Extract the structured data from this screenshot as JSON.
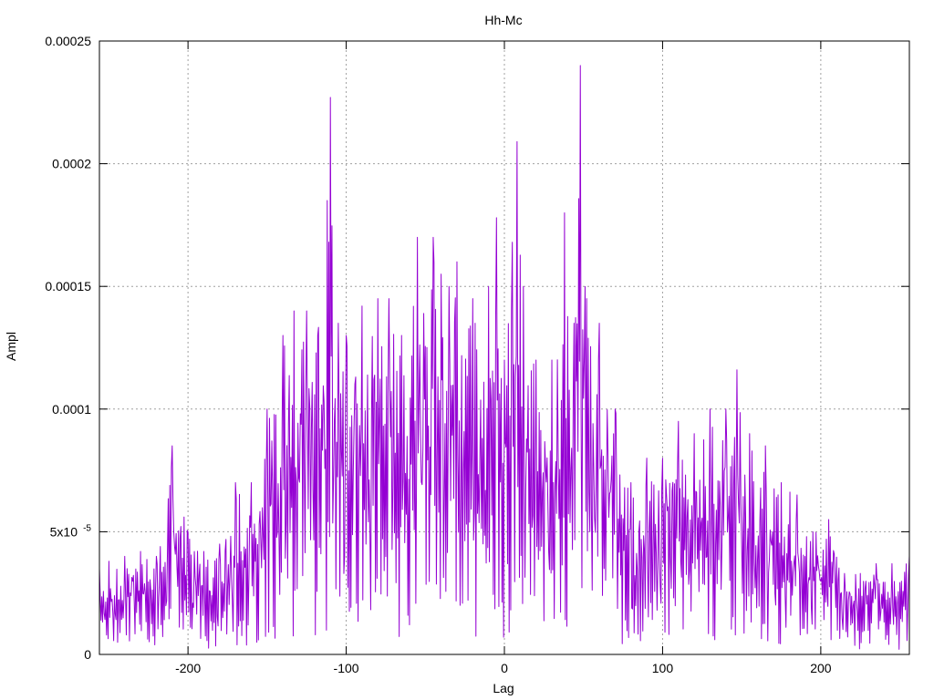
{
  "chart_data": {
    "type": "line",
    "title": "Hh-Mc",
    "xlabel": "Lag",
    "ylabel": "Ampl",
    "xlim": [
      -256,
      256
    ],
    "ylim": [
      0,
      0.00025
    ],
    "grid": true,
    "line_color": "#9400d3",
    "xticks": [
      {
        "value": -200,
        "label": "-200"
      },
      {
        "value": -100,
        "label": "-100"
      },
      {
        "value": 0,
        "label": "0"
      },
      {
        "value": 100,
        "label": "100"
      },
      {
        "value": 200,
        "label": "200"
      }
    ],
    "yticks": [
      {
        "value": 0,
        "label": "0"
      },
      {
        "value": 5e-05,
        "label": "5x10",
        "sup": "-5"
      },
      {
        "value": 0.0001,
        "label": "0.0001"
      },
      {
        "value": 0.00015,
        "label": "0.00015"
      },
      {
        "value": 0.0002,
        "label": "0.0002"
      },
      {
        "value": 0.00025,
        "label": "0.00025"
      }
    ],
    "series": [
      {
        "envelope": [
          [
            -256,
            3.5e-05
          ],
          [
            -250,
            3.8e-05
          ],
          [
            -240,
            4e-05
          ],
          [
            -230,
            4.2e-05
          ],
          [
            -220,
            4e-05
          ],
          [
            -210,
            8.5e-05
          ],
          [
            -200,
            5e-05
          ],
          [
            -190,
            4.2e-05
          ],
          [
            -180,
            4.5e-05
          ],
          [
            -170,
            7e-05
          ],
          [
            -160,
            7e-05
          ],
          [
            -150,
            0.0001
          ],
          [
            -140,
            0.00013
          ],
          [
            -133,
            0.00014
          ],
          [
            -125,
            0.00014
          ],
          [
            -118,
            0.00013
          ],
          [
            -112,
            0.000185
          ],
          [
            -110,
            0.000227
          ],
          [
            -105,
            0.000135
          ],
          [
            -100,
            0.00013
          ],
          [
            -90,
            0.000142
          ],
          [
            -80,
            0.000145
          ],
          [
            -73,
            0.000145
          ],
          [
            -65,
            0.00013
          ],
          [
            -55,
            0.00017
          ],
          [
            -45,
            0.00017
          ],
          [
            -40,
            0.000155
          ],
          [
            -35,
            0.00015
          ],
          [
            -30,
            0.00016
          ],
          [
            -20,
            0.000145
          ],
          [
            -10,
            0.00015
          ],
          [
            -5,
            0.000178
          ],
          [
            0,
            0.00012
          ],
          [
            5,
            0.000168
          ],
          [
            8,
            0.000209
          ],
          [
            12,
            0.00015
          ],
          [
            20,
            0.00012
          ],
          [
            30,
            0.00012
          ],
          [
            38,
            0.00018
          ],
          [
            44,
            0.000135
          ],
          [
            48,
            0.00024
          ],
          [
            52,
            0.000145
          ],
          [
            60,
            0.000135
          ],
          [
            70,
            0.0001
          ],
          [
            80,
            7e-05
          ],
          [
            90,
            8e-05
          ],
          [
            100,
            8e-05
          ],
          [
            110,
            9.5e-05
          ],
          [
            120,
            9e-05
          ],
          [
            130,
            0.0001
          ],
          [
            140,
            0.0001
          ],
          [
            147,
            0.000116
          ],
          [
            155,
            9e-05
          ],
          [
            165,
            8.5e-05
          ],
          [
            175,
            7e-05
          ],
          [
            185,
            6.5e-05
          ],
          [
            195,
            5e-05
          ],
          [
            205,
            5.5e-05
          ],
          [
            215,
            3.3e-05
          ],
          [
            225,
            3.3e-05
          ],
          [
            235,
            3.7e-05
          ],
          [
            245,
            3.7e-05
          ],
          [
            256,
            4e-05
          ]
        ]
      }
    ]
  }
}
